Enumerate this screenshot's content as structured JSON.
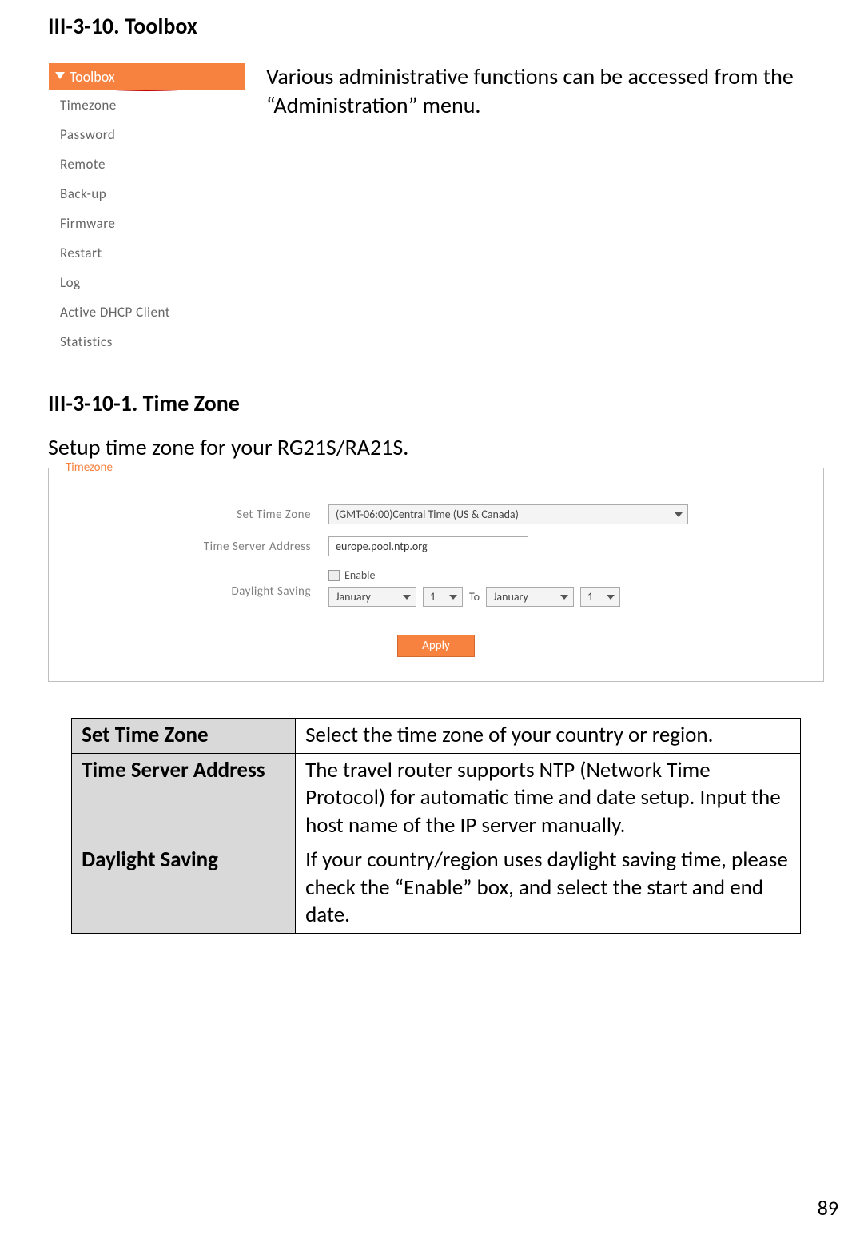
{
  "headings": {
    "h1": "III-3-10.     Toolbox",
    "h2": "III-3-10-1.  Time Zone"
  },
  "intro": "Various administrative functions can be accessed from the “Administration” menu.",
  "toolbox": {
    "header": "Toolbox",
    "items": [
      "Timezone",
      "Password",
      "Remote",
      "Back-up",
      "Firmware",
      "Restart",
      "Log",
      "Active DHCP Client",
      "Statistics"
    ]
  },
  "setup_text": "Setup time zone for your RG21S/RA21S.",
  "timezone_form": {
    "legend": "Timezone",
    "labels": {
      "set_time_zone": "Set Time Zone",
      "time_server": "Time Server Address",
      "daylight": "Daylight Saving"
    },
    "values": {
      "timezone": "(GMT-06:00)Central Time (US & Canada)",
      "server": "europe.pool.ntp.org",
      "enable_label": "Enable",
      "from_month": "January",
      "from_day": "1",
      "to_label": "To",
      "to_month": "January",
      "to_day": "1"
    },
    "apply": "Apply"
  },
  "table": {
    "rows": [
      {
        "k": "Set Time Zone",
        "v": "Select the time zone of your country or region."
      },
      {
        "k": "Time Server Address",
        "v": "The travel router supports NTP (Network Time Protocol) for automatic time and date setup. Input the host name of the IP server manually."
      },
      {
        "k": "Daylight Saving",
        "v": "If your country/region uses daylight saving time, please check the “Enable” box, and select the start and end date."
      }
    ]
  },
  "page_number": "89"
}
